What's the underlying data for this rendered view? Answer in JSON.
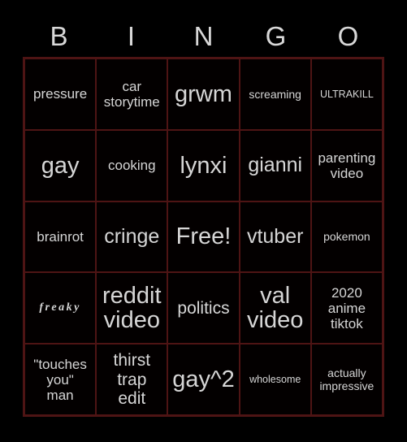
{
  "card": {
    "title": "BINGO",
    "background_color": "#000000",
    "grid_border_color": "#4e1414",
    "text_color": "#d6d6d6",
    "header_letters": [
      "B",
      "I",
      "N",
      "G",
      "O"
    ],
    "rows": 5,
    "columns": 5,
    "cells": [
      [
        {
          "text": "pressure",
          "size": "s-md"
        },
        {
          "text": "car\nstorytime",
          "size": "s-md"
        },
        {
          "text": "grwm",
          "size": "s-xxl"
        },
        {
          "text": "screaming",
          "size": "s-sm"
        },
        {
          "text": "ULTRAKILL",
          "size": "s-xs"
        }
      ],
      [
        {
          "text": "gay",
          "size": "s-xxl"
        },
        {
          "text": "cooking",
          "size": "s-md"
        },
        {
          "text": "lynxi",
          "size": "s-xxl"
        },
        {
          "text": "gianni",
          "size": "s-xl"
        },
        {
          "text": "parenting\nvideo",
          "size": "s-md"
        }
      ],
      [
        {
          "text": "brainrot",
          "size": "s-md"
        },
        {
          "text": "cringe",
          "size": "s-xl"
        },
        {
          "text": "Free!",
          "size": "s-xxl"
        },
        {
          "text": "vtuber",
          "size": "s-xl"
        },
        {
          "text": "pokemon",
          "size": "s-sm"
        }
      ],
      [
        {
          "text": "freaky",
          "size": "s-sm",
          "style": "fancy-serif"
        },
        {
          "text": "reddit\nvideo",
          "size": "s-xxl"
        },
        {
          "text": "politics",
          "size": "s-lg"
        },
        {
          "text": "val\nvideo",
          "size": "s-xxl"
        },
        {
          "text": "2020\nanime\ntiktok",
          "size": "s-md"
        }
      ],
      [
        {
          "text": "\"touches\nyou\"\nman",
          "size": "s-md"
        },
        {
          "text": "thirst\ntrap\nedit",
          "size": "s-lg"
        },
        {
          "text": "gay^2",
          "size": "s-xxl"
        },
        {
          "text": "wholesome",
          "size": "s-xs"
        },
        {
          "text": "actually\nimpressive",
          "size": "s-sm"
        }
      ]
    ]
  }
}
